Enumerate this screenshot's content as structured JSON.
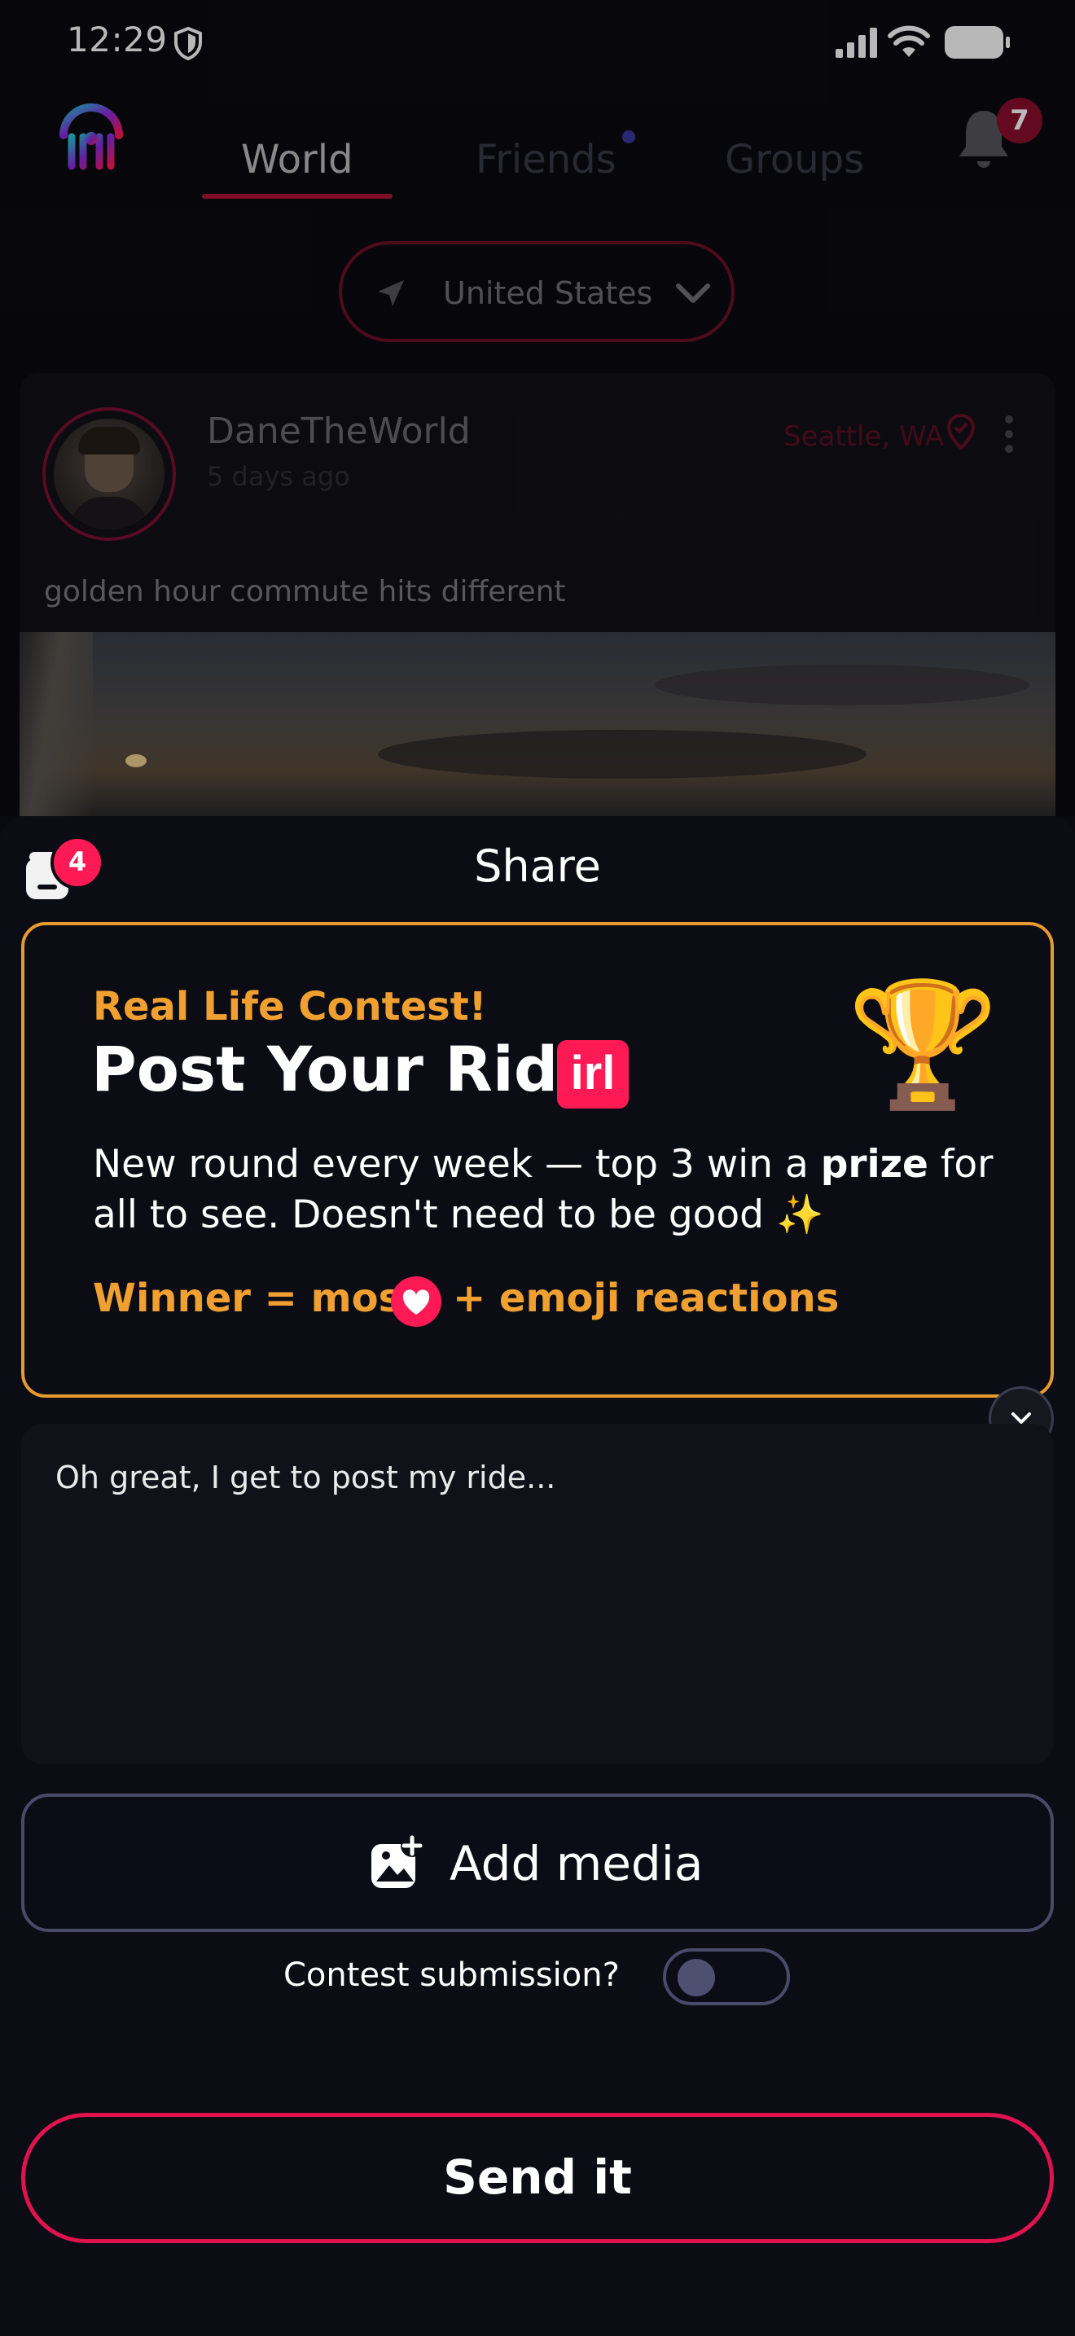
{
  "status_bar": {
    "time": "12:29"
  },
  "header": {
    "tabs": [
      {
        "label": "World",
        "active": true
      },
      {
        "label": "Friends",
        "active": false
      },
      {
        "label": "Groups",
        "active": false
      }
    ],
    "notification_count": "7"
  },
  "location_filter": {
    "value": "United States"
  },
  "post": {
    "username": "DaneTheWorld",
    "time_ago": "5 days ago",
    "location": "Seattle, WA",
    "caption": "golden hour commute hits different"
  },
  "share_sheet": {
    "title": "Share",
    "drafts_count": "4",
    "contest": {
      "eyebrow": "Real Life Contest!",
      "title": "Post Your Ride",
      "title_badge": "irl",
      "desc_part1": "New round every week — top 3 win a ",
      "desc_bold": "prize",
      "desc_part2": " for",
      "desc_line2": "all to see. Doesn't need to be good",
      "sparkle": "✨",
      "trophy": "🏆",
      "winner_prefix": "Winner = most",
      "winner_suffix": "+ emoji reactions"
    },
    "compose_text": "Oh great, I get to post my ride...",
    "add_media_label": "Add media",
    "contest_toggle_label": "Contest submission?",
    "contest_toggle_on": false,
    "send_label": "Send it"
  },
  "colors": {
    "accent_pink": "#ff1a55",
    "contest_orange": "#f0a030",
    "background": "#0a0a10"
  }
}
